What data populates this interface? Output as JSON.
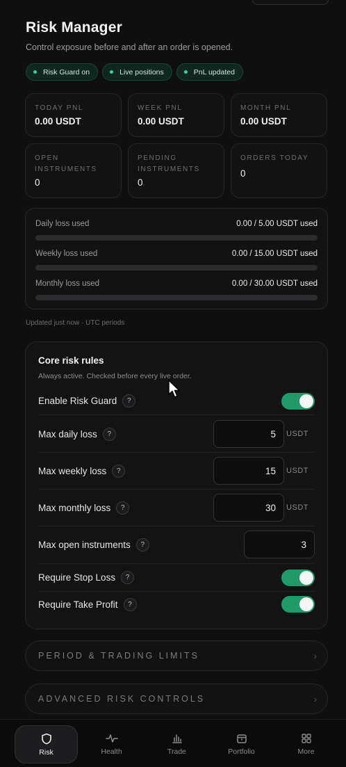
{
  "header": {
    "title": "Risk Manager",
    "subtitle": "Control exposure before and after an order is opened."
  },
  "chips": [
    "Risk Guard on",
    "Live positions",
    "PnL updated"
  ],
  "stats": [
    {
      "label": "TODAY PNL",
      "value": "0.00 USDT"
    },
    {
      "label": "WEEK PNL",
      "value": "0.00 USDT"
    },
    {
      "label": "MONTH PNL",
      "value": "0.00 USDT"
    },
    {
      "label": "OPEN INSTRUMENTS",
      "value": "0"
    },
    {
      "label": "PENDING INSTRUMENTS",
      "value": "0"
    },
    {
      "label": "ORDERS TODAY",
      "value": "0"
    }
  ],
  "loss_usage": [
    {
      "name": "Daily loss used",
      "amount": "0.00 / 5.00 USDT used",
      "fraction": 0
    },
    {
      "name": "Weekly loss used",
      "amount": "0.00 / 15.00 USDT used",
      "fraction": 0
    },
    {
      "name": "Monthly loss used",
      "amount": "0.00 / 30.00 USDT used",
      "fraction": 0
    }
  ],
  "updated_note": "Updated just now · UTC periods",
  "core_rules": {
    "title": "Core risk rules",
    "subtitle": "Always active. Checked before every live order.",
    "help_glyph": "?",
    "enable_guard": {
      "label": "Enable Risk Guard",
      "on": true
    },
    "max_daily_loss": {
      "label": "Max daily loss",
      "value": "5",
      "unit": "USDT"
    },
    "max_weekly_loss": {
      "label": "Max weekly loss",
      "value": "15",
      "unit": "USDT"
    },
    "max_monthly_loss": {
      "label": "Max monthly loss",
      "value": "30",
      "unit": "USDT"
    },
    "max_open_instruments": {
      "label": "Max open instruments",
      "value": "3"
    },
    "require_stop_loss": {
      "label": "Require Stop Loss",
      "on": true
    },
    "require_take_profit": {
      "label": "Require Take Profit",
      "on": true
    }
  },
  "sections": {
    "period_limits": "PERIOD & TRADING LIMITS",
    "advanced": "ADVANCED RISK CONTROLS",
    "chevron": "›"
  },
  "nav": {
    "items": [
      "Risk",
      "Health",
      "Trade",
      "Portfolio",
      "More"
    ],
    "active": "Risk"
  },
  "colors": {
    "accent": "#35d39a",
    "toggle_on": "#1f9a68",
    "background": "#0f0f10"
  }
}
